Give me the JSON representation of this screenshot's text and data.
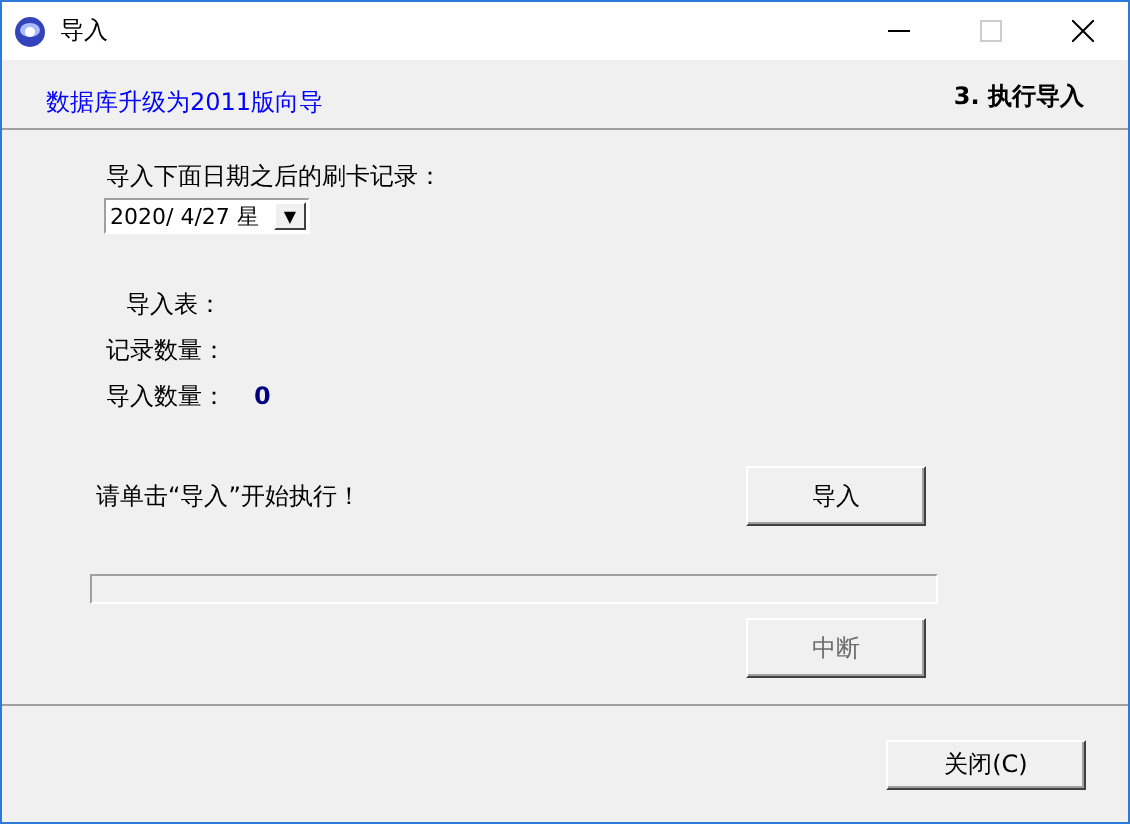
{
  "window": {
    "title": "导入"
  },
  "header": {
    "wizard_title": "数据库升级为2011版向导",
    "step": "3. 执行导入"
  },
  "date_label": "导入下面日期之后的刷卡记录：",
  "date_field": {
    "value": "2020/ 4/27 星",
    "arrow": "▼"
  },
  "info": [
    {
      "label": "导入表：",
      "indent": true
    },
    {
      "label": "记录数量：",
      "indent": false
    },
    {
      "label": "导入数量：",
      "value": "0",
      "indent": false
    }
  ],
  "prompt": "请单击“导入”开始执行！",
  "import_button": {
    "label": "导入",
    "disabled": false
  },
  "progress": {
    "level": 0
  },
  "abort_button": {
    "label": "中断",
    "disabled": true
  },
  "close_button": {
    "label": "关闭(C)",
    "disabled": false
  }
}
